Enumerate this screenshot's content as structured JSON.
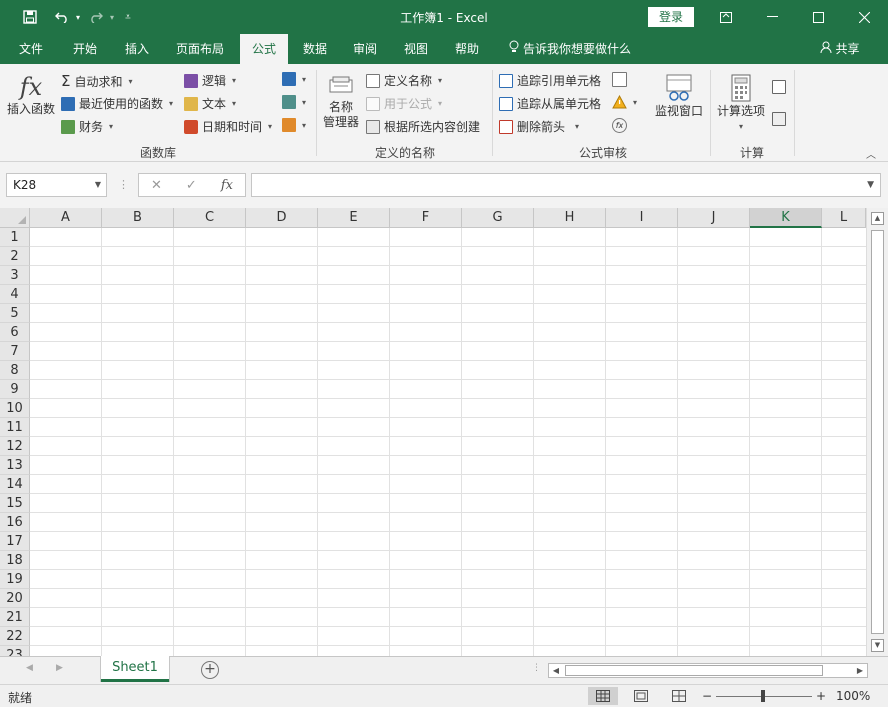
{
  "titlebar": {
    "title": "工作簿1  -  Excel",
    "login_label": "登录",
    "save_icon": "save-icon",
    "undo_icon": "undo-icon",
    "redo_icon": "redo-icon",
    "customize_icon": "customize-quick-access-icon",
    "restore_icon": "ribbon-display-options-icon",
    "minimize_icon": "minimize-icon",
    "maximize_icon": "maximize-icon",
    "close_icon": "close-icon"
  },
  "tabs": [
    "文件",
    "开始",
    "插入",
    "页面布局",
    "公式",
    "数据",
    "审阅",
    "视图",
    "帮助"
  ],
  "tell_me": "告诉我你想要做什么",
  "share": "共享",
  "ribbon": {
    "function_library": {
      "label": "函数库",
      "insert_function": "插入函数",
      "autosum": "自动求和",
      "recently_used": "最近使用的函数",
      "financial": "财务",
      "logical": "逻辑",
      "text": "文本",
      "date_time": "日期和时间"
    },
    "defined_names": {
      "label": "定义的名称",
      "name_manager_line1": "名称",
      "name_manager_line2": "管理器",
      "define_name": "定义名称",
      "use_in_formula": "用于公式",
      "create_from_selection": "根据所选内容创建"
    },
    "formula_auditing": {
      "label": "公式审核",
      "trace_precedents": "追踪引用单元格",
      "trace_dependents": "追踪从属单元格",
      "remove_arrows": "删除箭头",
      "watch_window": "监视窗口"
    },
    "calculation": {
      "label": "计算",
      "calc_options": "计算选项"
    }
  },
  "formula_bar": {
    "name_box": "K28",
    "cancel_icon": "✕",
    "enter_icon": "✓",
    "fx_label": "fx",
    "value": ""
  },
  "sheet": {
    "columns": [
      "A",
      "B",
      "C",
      "D",
      "E",
      "F",
      "G",
      "H",
      "I",
      "J",
      "K",
      "L"
    ],
    "selected_column": "K",
    "rows": [
      "1",
      "2",
      "3",
      "4",
      "5",
      "6",
      "7",
      "8",
      "9",
      "10",
      "11",
      "12",
      "13",
      "14",
      "15",
      "16",
      "17",
      "18",
      "19",
      "20",
      "21",
      "22",
      "23"
    ]
  },
  "sheet_tabs": [
    "Sheet1"
  ],
  "status": {
    "text": "就绪",
    "zoom": "100%",
    "zoom_minus": "−",
    "zoom_plus": "+"
  },
  "colors": {
    "accent": "#217346",
    "ribbon_bg": "#f3f3f3"
  }
}
